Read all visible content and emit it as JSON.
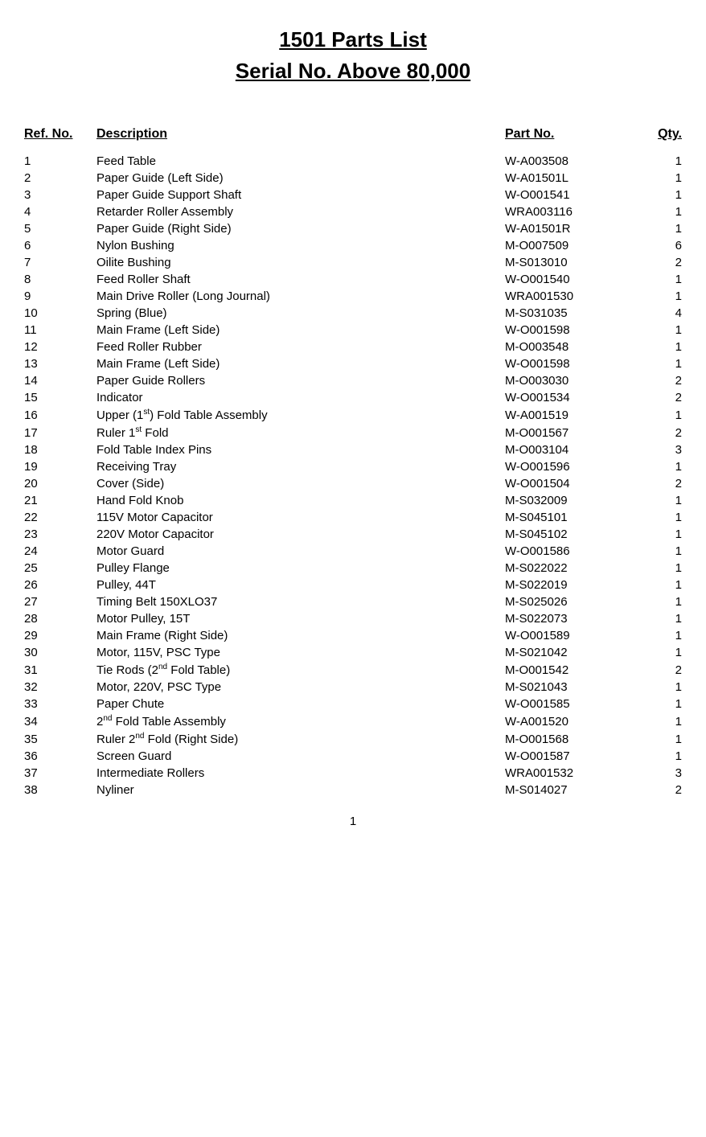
{
  "title": {
    "line1": "1501 Parts List",
    "line2": "Serial No. Above 80,000"
  },
  "headers": {
    "ref": "Ref. No.",
    "desc": "Description",
    "part": "Part No.",
    "qty": "Qty."
  },
  "rows": [
    {
      "ref": "1",
      "desc": "Feed Table",
      "part": "W-A003508",
      "qty": "1"
    },
    {
      "ref": "2",
      "desc": "Paper Guide (Left Side)",
      "part": "W-A01501L",
      "qty": "1"
    },
    {
      "ref": "3",
      "desc": "Paper Guide Support Shaft",
      "part": "W-O001541",
      "qty": "1"
    },
    {
      "ref": "4",
      "desc": "Retarder Roller Assembly",
      "part": "WRA003116",
      "qty": "1"
    },
    {
      "ref": "5",
      "desc": "Paper Guide (Right Side)",
      "part": "W-A01501R",
      "qty": "1"
    },
    {
      "ref": "6",
      "desc": "Nylon Bushing",
      "part": "M-O007509",
      "qty": "6"
    },
    {
      "ref": "7",
      "desc": "Oilite Bushing",
      "part": "M-S013010",
      "qty": "2"
    },
    {
      "ref": "8",
      "desc": "Feed Roller Shaft",
      "part": "W-O001540",
      "qty": "1"
    },
    {
      "ref": "9",
      "desc": "Main Drive Roller (Long Journal)",
      "part": "WRA001530",
      "qty": "1"
    },
    {
      "ref": "10",
      "desc": "Spring (Blue)",
      "part": "M-S031035",
      "qty": "4"
    },
    {
      "ref": "11",
      "desc": "Main Frame (Left Side)",
      "part": "W-O001598",
      "qty": "1"
    },
    {
      "ref": "12",
      "desc": "Feed Roller Rubber",
      "part": "M-O003548",
      "qty": "1"
    },
    {
      "ref": "13",
      "desc": "Main Frame (Left Side)",
      "part": "W-O001598",
      "qty": "1"
    },
    {
      "ref": "14",
      "desc": "Paper Guide Rollers",
      "part": "M-O003030",
      "qty": "2"
    },
    {
      "ref": "15",
      "desc": "Indicator",
      "part": "W-O001534",
      "qty": "2"
    },
    {
      "ref": "16",
      "desc": "Upper (1<sup>st</sup>) Fold Table Assembly",
      "part": "W-A001519",
      "qty": "1",
      "hasSup": true,
      "supText": "st",
      "descPre": "Upper (1",
      "descPost": ") Fold Table Assembly"
    },
    {
      "ref": "17",
      "desc": "Ruler 1<sup>st</sup> Fold",
      "part": "M-O001567",
      "qty": "2",
      "hasSup": true,
      "supText": "st",
      "descPre": "Ruler 1",
      "descPost": " Fold"
    },
    {
      "ref": "18",
      "desc": "Fold Table Index Pins",
      "part": "M-O003104",
      "qty": "3"
    },
    {
      "ref": "19",
      "desc": "Receiving Tray",
      "part": "W-O001596",
      "qty": "1"
    },
    {
      "ref": "20",
      "desc": "Cover (Side)",
      "part": "W-O001504",
      "qty": "2"
    },
    {
      "ref": "21",
      "desc": "Hand Fold Knob",
      "part": "M-S032009",
      "qty": "1"
    },
    {
      "ref": "22",
      "desc": "115V Motor Capacitor",
      "part": "M-S045101",
      "qty": "1"
    },
    {
      "ref": "23",
      "desc": "220V Motor Capacitor",
      "part": "M-S045102",
      "qty": "1"
    },
    {
      "ref": "24",
      "desc": "Motor Guard",
      "part": "W-O001586",
      "qty": "1"
    },
    {
      "ref": "25",
      "desc": "Pulley Flange",
      "part": "M-S022022",
      "qty": "1"
    },
    {
      "ref": "26",
      "desc": "Pulley, 44T",
      "part": "M-S022019",
      "qty": "1"
    },
    {
      "ref": "27",
      "desc": "Timing Belt 150XLO37",
      "part": "M-S025026",
      "qty": "1"
    },
    {
      "ref": "28",
      "desc": "Motor Pulley, 15T",
      "part": "M-S022073",
      "qty": "1"
    },
    {
      "ref": "29",
      "desc": "Main Frame (Right Side)",
      "part": "W-O001589",
      "qty": "1"
    },
    {
      "ref": "30",
      "desc": "Motor, 115V, PSC Type",
      "part": "M-S021042",
      "qty": "1"
    },
    {
      "ref": "31",
      "desc": "Tie Rods (2<sup>nd</sup> Fold Table)",
      "part": "M-O001542",
      "qty": "2",
      "hasSup": true,
      "supText": "nd",
      "descPre": "Tie Rods (2",
      "descPost": " Fold Table)"
    },
    {
      "ref": "32",
      "desc": "Motor, 220V, PSC Type",
      "part": "M-S021043",
      "qty": "1"
    },
    {
      "ref": "33",
      "desc": "Paper Chute",
      "part": "W-O001585",
      "qty": "1"
    },
    {
      "ref": "34",
      "desc": "2<sup>nd</sup> Fold Table Assembly",
      "part": "W-A001520",
      "qty": "1",
      "hasSup": true,
      "supText": "nd",
      "descPre": "2",
      "descPost": " Fold Table Assembly"
    },
    {
      "ref": "35",
      "desc": "Ruler 2<sup>nd</sup> Fold (Right Side)",
      "part": "M-O001568",
      "qty": "1",
      "hasSup": true,
      "supText": "nd",
      "descPre": "Ruler 2",
      "descPost": " Fold (Right Side)"
    },
    {
      "ref": "36",
      "desc": "Screen Guard",
      "part": "W-O001587",
      "qty": "1"
    },
    {
      "ref": "37",
      "desc": "Intermediate Rollers",
      "part": "WRA001532",
      "qty": "3"
    },
    {
      "ref": "38",
      "desc": "Nyliner",
      "part": "M-S014027",
      "qty": "2"
    }
  ],
  "footer": {
    "page": "1"
  }
}
